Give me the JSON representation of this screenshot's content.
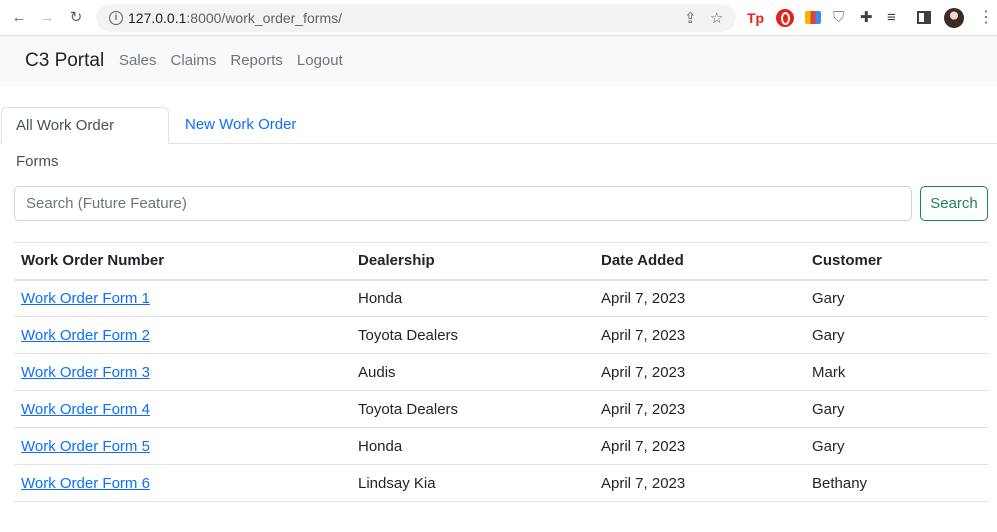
{
  "browser": {
    "url_host": "127.0.0.1",
    "url_path": ":8000/work_order_forms/"
  },
  "navbar": {
    "brand": "C3 Portal",
    "links": [
      "Sales",
      "Claims",
      "Reports",
      "Logout"
    ]
  },
  "tabs": [
    {
      "label": "All Work Order Forms",
      "active": true
    },
    {
      "label": "New Work Order",
      "active": false
    }
  ],
  "search": {
    "placeholder": "Search (Future Feature)",
    "button_label": "Search"
  },
  "table": {
    "columns": [
      "Work Order Number",
      "Dealership",
      "Date Added",
      "Customer"
    ],
    "rows": [
      {
        "number": "Work Order Form 1",
        "dealership": "Honda",
        "date": "April 7, 2023",
        "customer": "Gary"
      },
      {
        "number": "Work Order Form 2",
        "dealership": "Toyota Dealers",
        "date": "April 7, 2023",
        "customer": "Gary"
      },
      {
        "number": "Work Order Form 3",
        "dealership": "Audis",
        "date": "April 7, 2023",
        "customer": "Mark"
      },
      {
        "number": "Work Order Form 4",
        "dealership": "Toyota Dealers",
        "date": "April 7, 2023",
        "customer": "Gary"
      },
      {
        "number": "Work Order Form 5",
        "dealership": "Honda",
        "date": "April 7, 2023",
        "customer": "Gary"
      },
      {
        "number": "Work Order Form 6",
        "dealership": "Lindsay Kia",
        "date": "April 7, 2023",
        "customer": "Bethany"
      }
    ]
  },
  "colors": {
    "link": "#0d6efd",
    "success": "#198754",
    "navbar_bg": "#f8f9fa"
  },
  "icons": [
    "back-arrow-icon",
    "forward-arrow-icon",
    "reload-icon",
    "info-icon",
    "share-icon",
    "star-icon",
    "extensions-icon",
    "kebab-menu-icon"
  ]
}
